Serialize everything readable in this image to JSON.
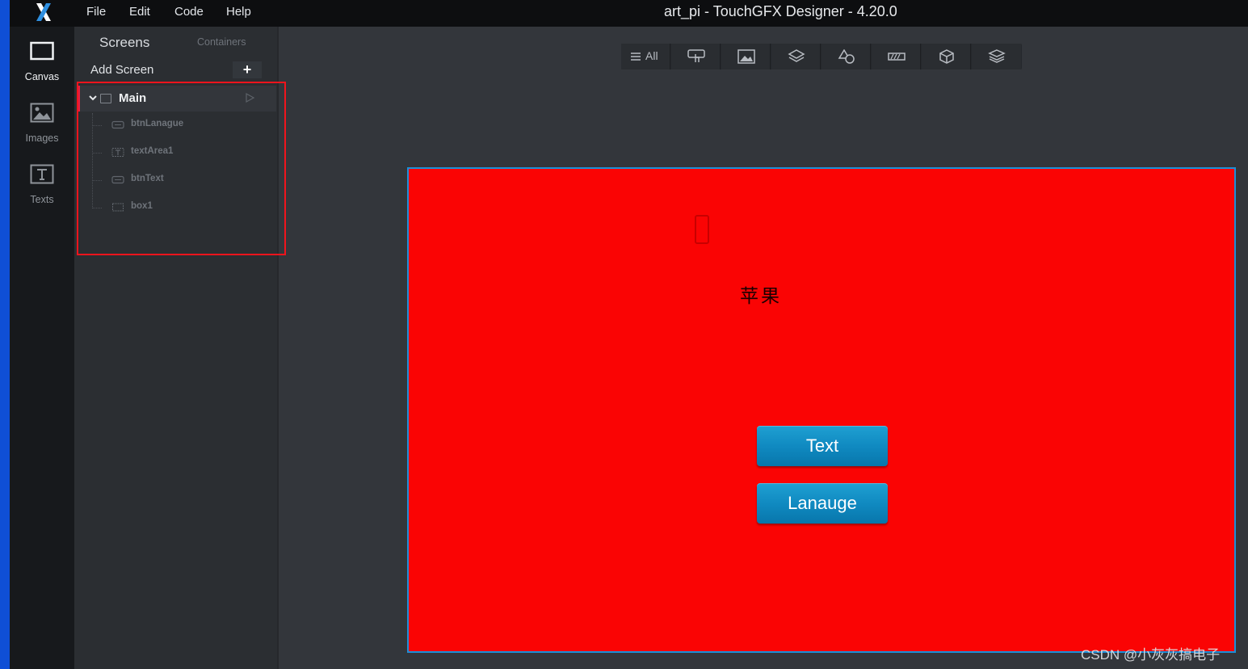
{
  "app": {
    "title": "art_pi - TouchGFX Designer - 4.20.0",
    "logo_icon": "touchgfx-x-logo-icon"
  },
  "menu": {
    "items": [
      "File",
      "Edit",
      "Code",
      "Help"
    ]
  },
  "navrail": {
    "items": [
      {
        "label": "Canvas",
        "icon": "canvas-icon",
        "active": true
      },
      {
        "label": "Images",
        "icon": "images-icon",
        "active": false
      },
      {
        "label": "Texts",
        "icon": "texts-icon",
        "active": false
      }
    ]
  },
  "panel": {
    "tabs": {
      "screens": "Screens",
      "containers": "Containers"
    },
    "add_screen_label": "Add Screen",
    "add_button_label": "+",
    "screen": {
      "name": "Main",
      "expanded": true,
      "widgets": [
        {
          "name": "btnLanague",
          "icon": "button-widget-icon"
        },
        {
          "name": "textArea1",
          "icon": "textarea-widget-icon"
        },
        {
          "name": "btnText",
          "icon": "button-widget-icon"
        },
        {
          "name": "box1",
          "icon": "box-widget-icon"
        }
      ]
    }
  },
  "toolbar": {
    "all_label": "All",
    "filters": [
      "interaction-icon",
      "image-icon",
      "containers-icon",
      "shapes-icon",
      "progress-icon",
      "3d-icon",
      "layers-icon"
    ]
  },
  "canvas": {
    "background_color": "#fa0404",
    "text": "苹果",
    "buttons": {
      "text_button": "Text",
      "language_button": "Lanauge"
    }
  },
  "watermark": "CSDN @小灰灰搞电子",
  "colors": {
    "accent_blue": "#1c8fd8",
    "highlight_red": "#f0141c",
    "button_blue": "#108ac1"
  }
}
